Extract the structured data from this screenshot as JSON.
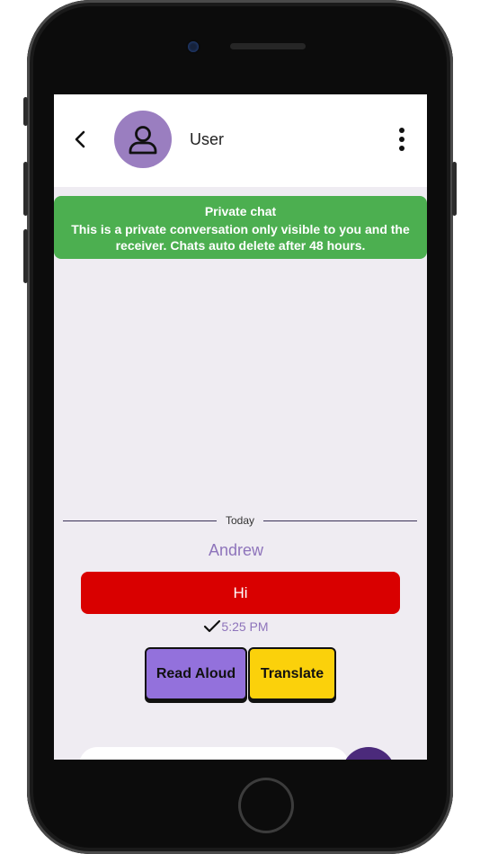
{
  "header": {
    "username": "User"
  },
  "banner": {
    "title": "Private chat",
    "text": "This is a private conversation only visible to you and the receiver. Chats auto delete after 48 hours."
  },
  "chat": {
    "day_label": "Today",
    "messages": [
      {
        "sender": "Andrew",
        "text": "Hi",
        "time": "5:25 PM",
        "status": "sent"
      }
    ]
  },
  "actions": {
    "read_aloud_label": "Read Aloud",
    "translate_label": "Translate"
  },
  "colors": {
    "avatar": "#9a7ec0",
    "banner": "#4caf50",
    "bubble": "#d90000",
    "accent_text": "#8e74bb",
    "read_aloud": "#9371dc",
    "translate": "#fbd10b",
    "send_button": "#4b2a7b"
  },
  "icons": [
    "back-arrow-icon",
    "user-avatar-icon",
    "more-vert-icon",
    "check-icon"
  ]
}
